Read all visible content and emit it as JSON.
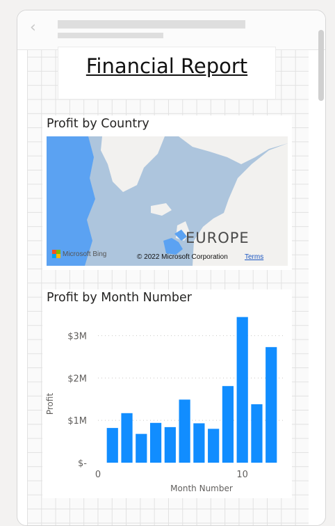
{
  "report": {
    "title": "Financial Report"
  },
  "map_visual": {
    "title": "Profit by Country",
    "region_label": "EUROPE",
    "attribution": "© 2022 Microsoft Corporation",
    "terms_label": "Terms",
    "provider": "Microsoft Bing"
  },
  "chart_visual": {
    "title": "Profit by Month Number"
  },
  "chart_data": {
    "type": "bar",
    "title": "Profit by Month Number",
    "xlabel": "Month Number",
    "ylabel": "Profit",
    "x": [
      1,
      2,
      3,
      4,
      5,
      6,
      7,
      8,
      9,
      10,
      11,
      12
    ],
    "values": [
      0.82,
      1.17,
      0.68,
      0.94,
      0.84,
      1.49,
      0.93,
      0.8,
      1.81,
      3.44,
      1.38,
      2.73
    ],
    "ylim": [
      0,
      3.5
    ],
    "xlim": [
      0,
      13
    ],
    "y_ticks": [
      0,
      1,
      2,
      3
    ],
    "y_tick_labels": [
      "$-",
      "$1M",
      "$2M",
      "$3M"
    ],
    "x_ticks": [
      0,
      10
    ],
    "x_tick_labels": [
      "0",
      "10"
    ],
    "bar_color": "#118dff",
    "grid": true
  },
  "colors": {
    "bar": "#118dff",
    "map_land": "#f2f1ef",
    "map_water": "#adc5dd",
    "map_highlight": "#5ba2f2"
  }
}
